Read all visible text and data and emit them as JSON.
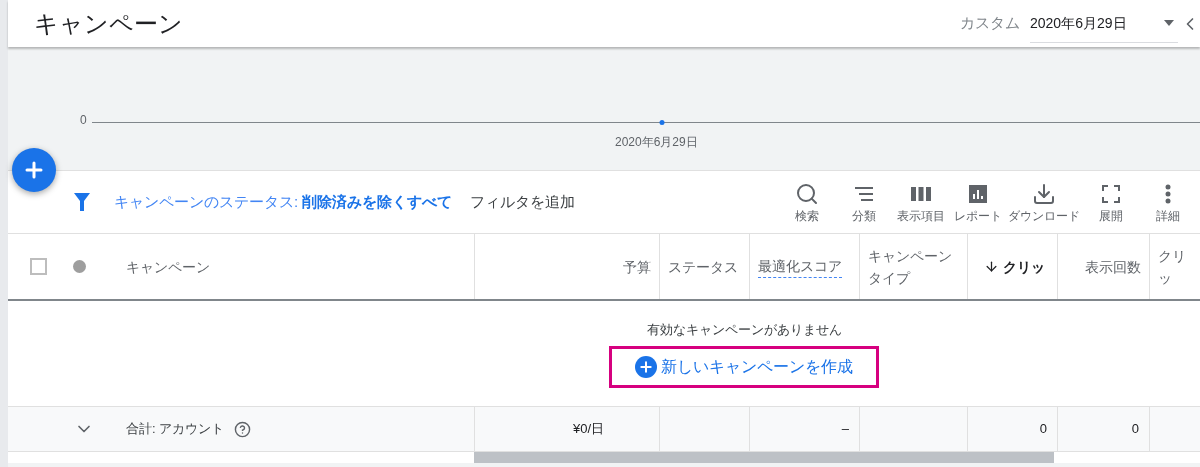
{
  "page_title": "キャンペーン",
  "date_range": {
    "label": "カスタム",
    "value": "2020年6月29日"
  },
  "chart": {
    "y_labels": [
      "0"
    ],
    "x_label": "2020年6月29日"
  },
  "filter": {
    "text": "キャンペーンのステータス: **削除済みを除くすべて**",
    "add_label": "フィルタを追加"
  },
  "toolbar": [
    {
      "kind": "search",
      "label": "検索"
    },
    {
      "kind": "sort",
      "label": "分類"
    },
    {
      "kind": "columns",
      "label": "表示項目"
    },
    {
      "kind": "report",
      "label": "レポート"
    },
    {
      "kind": "download",
      "label": "ダウンロード"
    },
    {
      "kind": "expand",
      "label": "展開"
    },
    {
      "kind": "more",
      "label": "詳細"
    }
  ],
  "table": {
    "select_all_checked": false,
    "columns": [
      {
        "label": "キャンペーン",
        "underlined": false,
        "sorted": false
      },
      {
        "label": "予算",
        "underlined": false,
        "sorted": false
      },
      {
        "label": "ステータス",
        "underlined": false,
        "sorted": false
      },
      {
        "label": "最適化スコア",
        "underlined": true,
        "sorted": false
      },
      {
        "label": "キャンペーンタイプ",
        "underlined": false,
        "sorted": false
      },
      {
        "label": "クリッ",
        "underlined": false,
        "sorted": true
      },
      {
        "label": "表示回数",
        "underlined": false,
        "sorted": false
      },
      {
        "label": "クリッ",
        "underlined": false,
        "sorted": false
      }
    ],
    "empty_message": "有効なキャンペーンがありません",
    "create_label": "新しいキャンペーンを作成",
    "total": {
      "label": "合計: アカウント",
      "cells": [
        "¥0/日",
        "",
        "–",
        "",
        "0",
        "0",
        ""
      ]
    }
  }
}
